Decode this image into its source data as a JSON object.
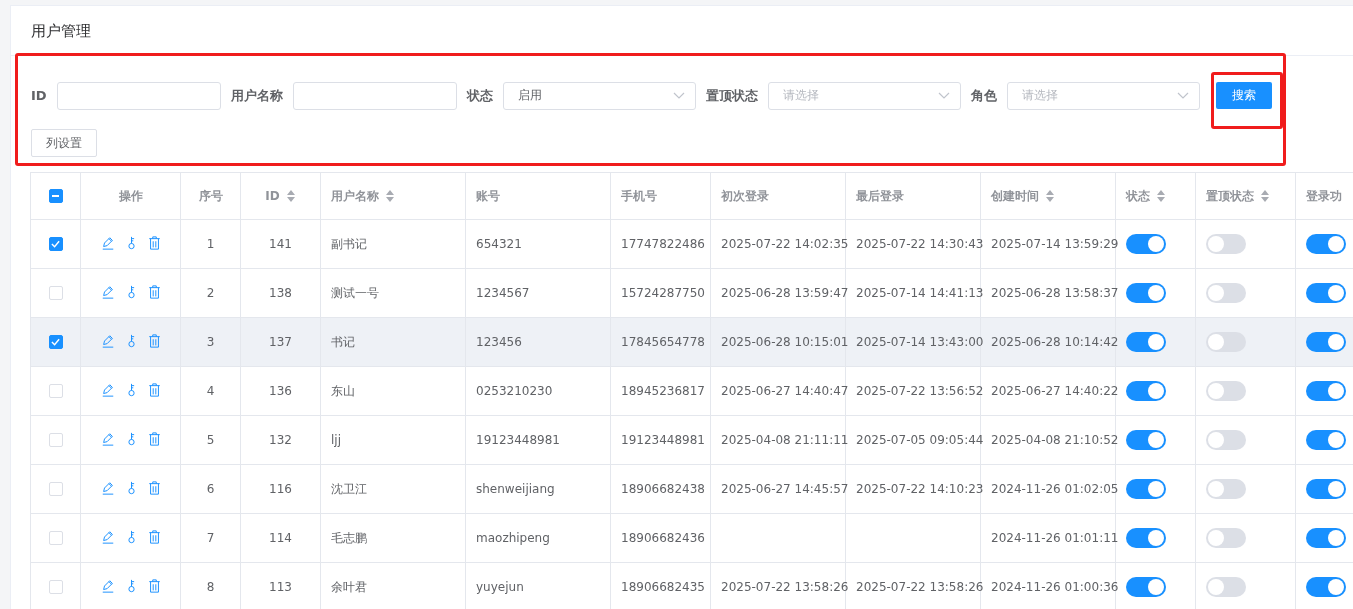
{
  "page": {
    "title": "用户管理"
  },
  "filters": [
    {
      "label": "ID",
      "kind": "input"
    },
    {
      "label": "用户名称",
      "kind": "input"
    },
    {
      "label": "状态",
      "kind": "select",
      "value": "启用"
    },
    {
      "label": "置顶状态",
      "kind": "select",
      "placeholder": "请选择"
    },
    {
      "label": "角色",
      "kind": "select",
      "placeholder": "请选择"
    }
  ],
  "search_button": "搜索",
  "column_settings_button": "列设置",
  "table": {
    "select_all": {
      "indeterminate": true
    },
    "columns": [
      {
        "label": "操作",
        "sortable": false
      },
      {
        "label": "序号",
        "sortable": false
      },
      {
        "label": "ID",
        "sortable": true
      },
      {
        "label": "用户名称",
        "sortable": true
      },
      {
        "label": "账号",
        "sortable": false
      },
      {
        "label": "手机号",
        "sortable": false
      },
      {
        "label": "初次登录",
        "sortable": false
      },
      {
        "label": "最后登录",
        "sortable": false
      },
      {
        "label": "创建时间",
        "sortable": true
      },
      {
        "label": "状态",
        "sortable": true
      },
      {
        "label": "置顶状态",
        "sortable": true
      },
      {
        "label": "登录功",
        "sortable": false
      }
    ],
    "rows": [
      {
        "checked": true,
        "highlighted": false,
        "seq": "1",
        "id": "141",
        "name": "副书记",
        "account": "654321",
        "phone": "17747822486",
        "first_login": "2025-07-22 14:02:35",
        "last_login": "2025-07-22 14:30:43",
        "created": "2025-07-14 13:59:29",
        "status_on": true,
        "pinned_on": false,
        "login_on": true
      },
      {
        "checked": false,
        "highlighted": false,
        "seq": "2",
        "id": "138",
        "name": "测试一号",
        "account": "1234567",
        "phone": "15724287750",
        "first_login": "2025-06-28 13:59:47",
        "last_login": "2025-07-14 14:41:13",
        "created": "2025-06-28 13:58:37",
        "status_on": true,
        "pinned_on": false,
        "login_on": true
      },
      {
        "checked": true,
        "highlighted": true,
        "seq": "3",
        "id": "137",
        "name": "书记",
        "account": "123456",
        "phone": "17845654778",
        "first_login": "2025-06-28 10:15:01",
        "last_login": "2025-07-14 13:43:00",
        "created": "2025-06-28 10:14:42",
        "status_on": true,
        "pinned_on": false,
        "login_on": true
      },
      {
        "checked": false,
        "highlighted": false,
        "seq": "4",
        "id": "136",
        "name": "东山",
        "account": "0253210230",
        "phone": "18945236817",
        "first_login": "2025-06-27 14:40:47",
        "last_login": "2025-07-22 13:56:52",
        "created": "2025-06-27 14:40:22",
        "status_on": true,
        "pinned_on": false,
        "login_on": true
      },
      {
        "checked": false,
        "highlighted": false,
        "seq": "5",
        "id": "132",
        "name": "ljj",
        "account": "19123448981",
        "phone": "19123448981",
        "first_login": "2025-04-08 21:11:11",
        "last_login": "2025-07-05 09:05:44",
        "created": "2025-04-08 21:10:52",
        "status_on": true,
        "pinned_on": false,
        "login_on": true
      },
      {
        "checked": false,
        "highlighted": false,
        "seq": "6",
        "id": "116",
        "name": "沈卫江",
        "account": "shenweijiang",
        "phone": "18906682438",
        "first_login": "2025-06-27 14:45:57",
        "last_login": "2025-07-22 14:10:23",
        "created": "2024-11-26 01:02:05",
        "status_on": true,
        "pinned_on": false,
        "login_on": true
      },
      {
        "checked": false,
        "highlighted": false,
        "seq": "7",
        "id": "114",
        "name": "毛志鹏",
        "account": "maozhipeng",
        "phone": "18906682436",
        "created": "2024-11-26 01:01:11",
        "status_on": true,
        "pinned_on": false,
        "login_on": true
      },
      {
        "checked": false,
        "highlighted": false,
        "seq": "8",
        "id": "113",
        "name": "余叶君",
        "account": "yuyejun",
        "phone": "18906682435",
        "first_login": "2025-07-22 13:58:26",
        "last_login": "2025-07-22 13:58:26",
        "created": "2024-11-26 01:00:36",
        "status_on": true,
        "pinned_on": false,
        "login_on": true
      }
    ]
  }
}
